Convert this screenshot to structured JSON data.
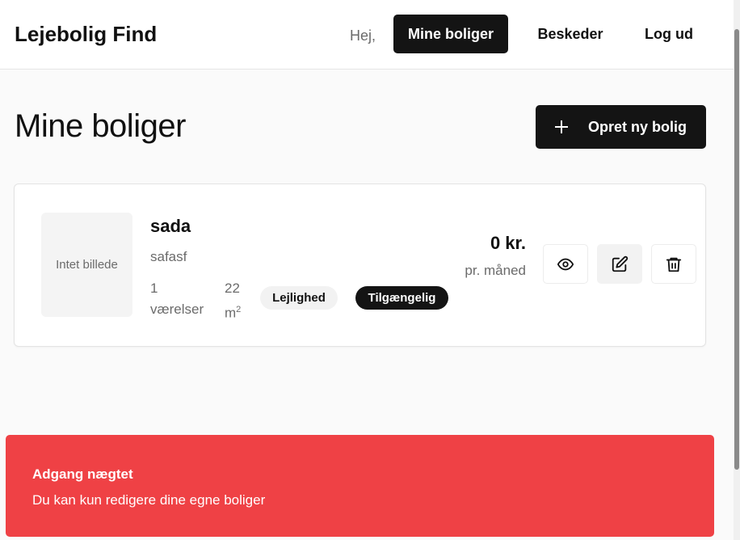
{
  "header": {
    "brand": "Lejebolig Find",
    "greeting": "Hej,",
    "nav": {
      "my_listings": "Mine boliger",
      "messages": "Beskeder",
      "logout": "Log ud"
    }
  },
  "main": {
    "title": "Mine boliger",
    "create_button": "Opret ny bolig",
    "listings": [
      {
        "image_placeholder": "Intet billede",
        "title": "sada",
        "description": "safasf",
        "rooms": "1",
        "rooms_label": "værelser",
        "size": "22",
        "size_unit": "m",
        "size_unit_sup": "2",
        "type": "Lejlighed",
        "status": "Tilgængelig",
        "price": "0 kr.",
        "price_unit": "pr. måned",
        "actions": [
          "eye-icon",
          "edit-icon",
          "trash-icon"
        ]
      }
    ]
  },
  "toast": {
    "title": "Adgang nægtet",
    "message": "Du kan kun redigere dine egne boliger"
  },
  "colors": {
    "primary": "#141414",
    "danger": "#ef4145",
    "background": "#fafafa",
    "muted_text": "#6b6b6b"
  }
}
